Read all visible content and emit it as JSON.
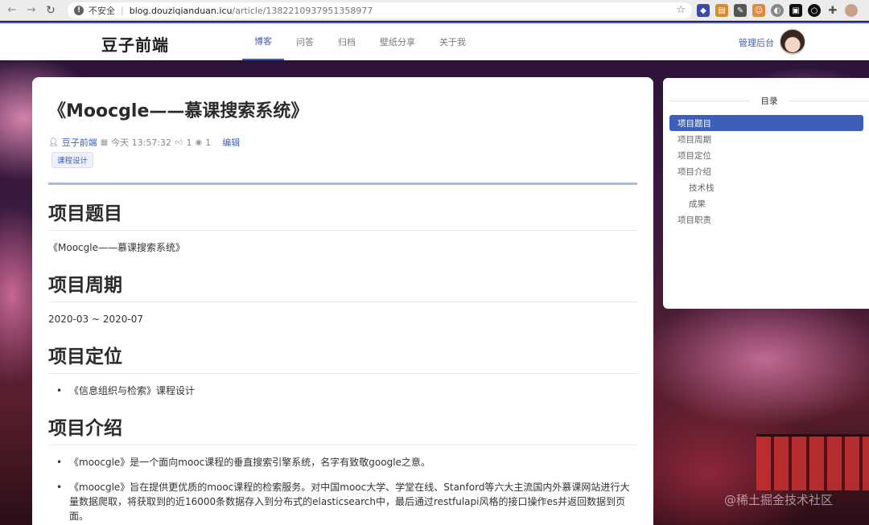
{
  "browser": {
    "insecure_label": "不安全",
    "url_host": "blog.douziqianduan.icu",
    "url_path": "/article/1382210937951358977",
    "extensions": [
      {
        "icon": "extension-a-icon",
        "color": "#3b4aa8"
      },
      {
        "icon": "extension-b-icon",
        "color": "#d98a2b"
      },
      {
        "icon": "extension-c-icon",
        "color": "#555555"
      },
      {
        "icon": "extension-d-icon",
        "color": "#e08a3a"
      },
      {
        "icon": "extension-e-icon",
        "color": "#888888"
      },
      {
        "icon": "extension-f-icon",
        "color": "#111111"
      },
      {
        "icon": "extension-g-icon",
        "color": "#111111"
      },
      {
        "icon": "puzzle-icon",
        "color": "#555555"
      }
    ]
  },
  "site": {
    "logo_text": "豆子前端",
    "nav": [
      "博客",
      "问答",
      "归档",
      "壁纸分享",
      "关于我"
    ],
    "admin_link": "管理后台",
    "accent_color": "#3d5fb8"
  },
  "article": {
    "title": "《Moocgle——慕课搜索系统》",
    "author": "豆子前端",
    "time": "今天 13:57:32",
    "likes": "1",
    "views": "1",
    "edit_label": "编辑",
    "tag": "课程设计",
    "sections": {
      "s1_heading": "项目题目",
      "s1_text": "《Moocgle——慕课搜索系统》",
      "s2_heading": "项目周期",
      "s2_text": "2020-03 ~ 2020-07",
      "s3_heading": "项目定位",
      "s3_bullet": "《信息组织与检索》课程设计",
      "s4_heading": "项目介绍",
      "s4_bullet1": "《moocgle》是一个面向mooc课程的垂直搜索引擎系统，名字有致敬google之意。",
      "s4_bullet2": "《moocgle》旨在提供更优质的mooc课程的检索服务。对中国mooc大学、学堂在线、Stanford等六大主流国内外慕课网站进行大量数据爬取，将获取到的近16000条数据存入到分布式的elasticsearch中，最后通过restfulapi风格的接口操作es并返回数据到页面。"
    }
  },
  "toc": {
    "title": "目录",
    "items": [
      {
        "label": "项目题目",
        "active": true,
        "sub": false
      },
      {
        "label": "项目周期",
        "active": false,
        "sub": false
      },
      {
        "label": "项目定位",
        "active": false,
        "sub": false
      },
      {
        "label": "项目介绍",
        "active": false,
        "sub": false
      },
      {
        "label": "技术栈",
        "active": false,
        "sub": true
      },
      {
        "label": "成果",
        "active": false,
        "sub": true
      },
      {
        "label": "项目职责",
        "active": false,
        "sub": false
      }
    ]
  },
  "watermark": "@稀土掘金技术社区"
}
